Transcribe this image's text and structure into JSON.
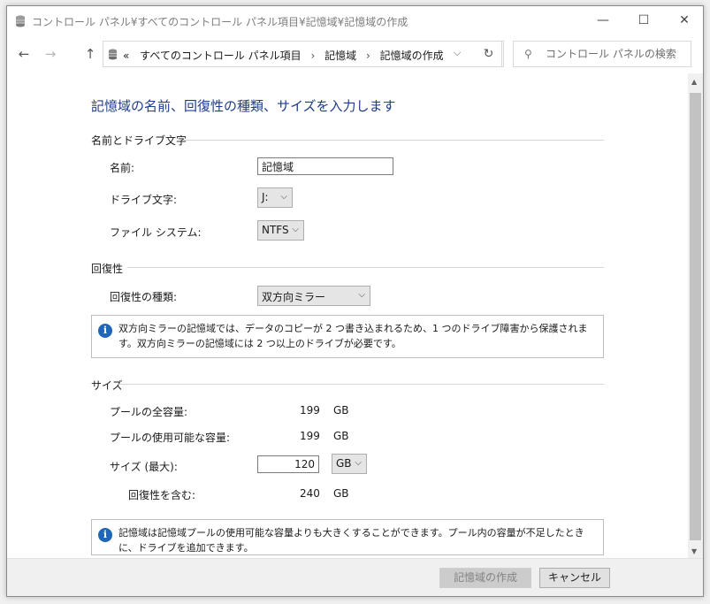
{
  "window": {
    "title": "コントロール パネル¥すべてのコントロール パネル項目¥記憶域¥記憶域の作成",
    "minimize_glyph": "—",
    "maximize_glyph": "☐",
    "close_glyph": "✕"
  },
  "nav": {
    "back_glyph": "←",
    "forward_glyph": "→",
    "up_glyph": "↑",
    "breadcrumb_prefix": "«",
    "breadcrumbs": [
      "すべてのコントロール パネル項目",
      "記憶域",
      "記憶域の作成"
    ],
    "separator": "›",
    "dropdown_glyph": "⌵",
    "refresh_glyph": "↻",
    "search_placeholder": "コントロール パネルの検索",
    "search_glyph": "⚲"
  },
  "form": {
    "heading": "記憶域の名前、回復性の種類、サイズを入力します",
    "name_section": {
      "title": "名前とドライブ文字",
      "name_label": "名前:",
      "name_value": "記憶域",
      "drive_label": "ドライブ文字:",
      "drive_value": "J:",
      "fs_label": "ファイル システム:",
      "fs_value": "NTFS"
    },
    "resiliency_section": {
      "title": "回復性",
      "type_label": "回復性の種類:",
      "type_value": "双方向ミラー",
      "info_text": "双方向ミラーの記憶域では、データのコピーが 2 つ書き込まれるため、1 つのドライブ障害から保護されます。双方向ミラーの記憶域には 2 つ以上のドライブが必要です。"
    },
    "size_section": {
      "title": "サイズ",
      "total_label": "プールの全容量:",
      "total_value": "199",
      "total_unit": "GB",
      "available_label": "プールの使用可能な容量:",
      "available_value": "199",
      "available_unit": "GB",
      "max_label": "サイズ (最大):",
      "max_value": "120",
      "max_unit": "GB",
      "incl_label": "回復性を含む:",
      "incl_value": "240",
      "incl_unit": "GB",
      "info_text": "記憶域は記憶域プールの使用可能な容量よりも大きくすることができます。プール内の容量が不足したときに、ドライブを追加できます。"
    }
  },
  "footer": {
    "create_label": "記憶域の作成",
    "cancel_label": "キャンセル"
  },
  "colors": {
    "heading": "#1e3c8c",
    "info_icon": "#2066b6"
  }
}
